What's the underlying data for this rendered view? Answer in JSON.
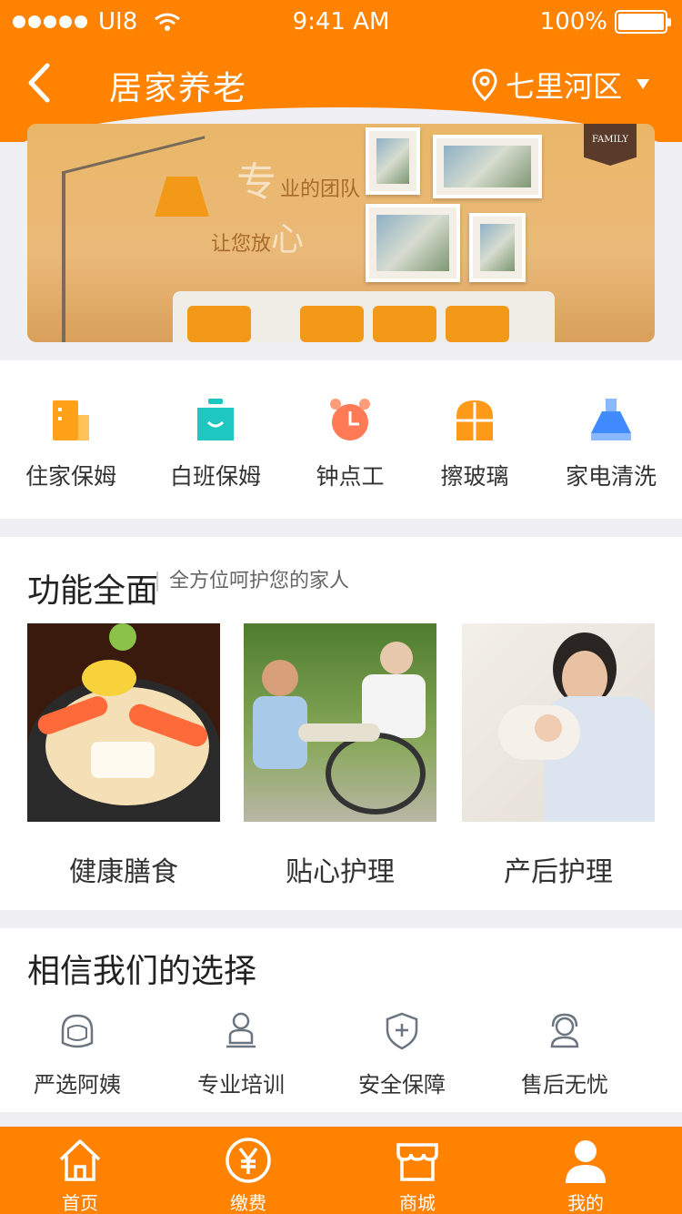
{
  "status_bar": {
    "carrier": "UI8",
    "time": "9:41 AM",
    "battery": "100%"
  },
  "nav": {
    "title": "居家养老",
    "location": "七里河区"
  },
  "banner": {
    "line1_big": "专",
    "line1_small": "业的团队",
    "line2_small": "让您放",
    "line2_big": "心",
    "family_tag": "FAMILY"
  },
  "services": [
    {
      "label": "住家保姆",
      "icon": "building-icon",
      "color": "#ffa21a"
    },
    {
      "label": "白班保姆",
      "icon": "apron-icon",
      "color": "#1ec7c0"
    },
    {
      "label": "钟点工",
      "icon": "alarm-clock-icon",
      "color": "#ff7a55"
    },
    {
      "label": "擦玻璃",
      "icon": "window-icon",
      "color": "#ff9a18"
    },
    {
      "label": "家电清洗",
      "icon": "range-hood-icon",
      "color": "#3f8bff"
    }
  ],
  "features": {
    "title": "功能全面",
    "subtitle": "全方位呵护您的家人",
    "items": [
      {
        "label": "健康膳食"
      },
      {
        "label": "贴心护理"
      },
      {
        "label": "产后护理"
      }
    ]
  },
  "trust": {
    "title": "相信我们的选择",
    "items": [
      {
        "label": "严选阿姨",
        "icon": "auntie-icon"
      },
      {
        "label": "专业培训",
        "icon": "training-icon"
      },
      {
        "label": "安全保障",
        "icon": "shield-icon"
      },
      {
        "label": "售后无忧",
        "icon": "service-agent-icon"
      }
    ]
  },
  "tabbar": [
    {
      "label": "首页",
      "icon": "home-icon"
    },
    {
      "label": "缴费",
      "icon": "yen-icon"
    },
    {
      "label": "商城",
      "icon": "store-icon"
    },
    {
      "label": "我的",
      "icon": "user-icon"
    }
  ],
  "colors": {
    "brand": "#ff8200",
    "background": "#efeff4"
  }
}
